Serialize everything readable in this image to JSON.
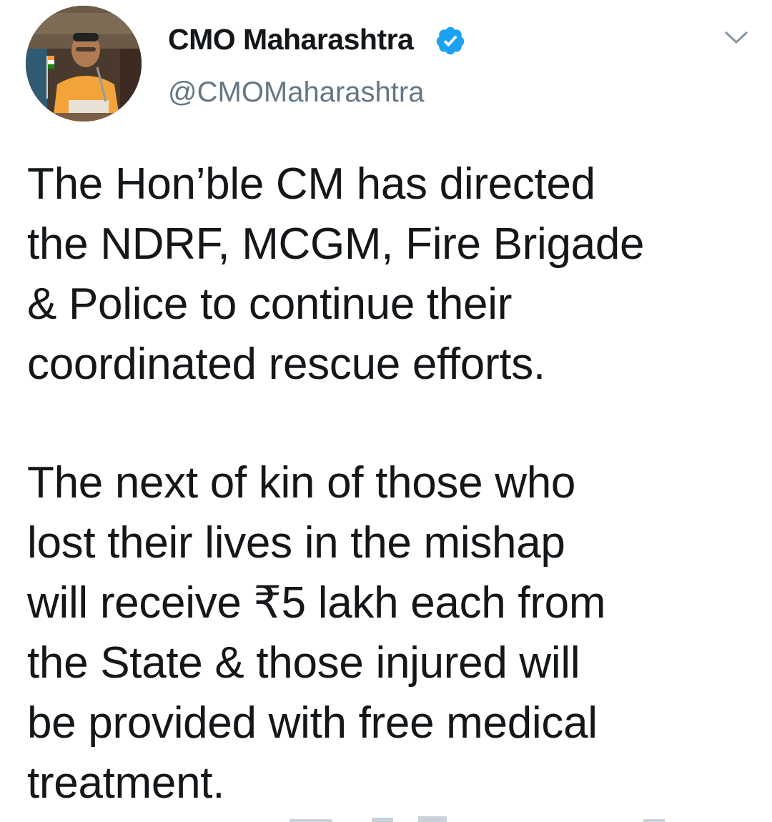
{
  "tweet": {
    "display_name": "CMO Maharashtra",
    "handle": "@CMOMaharashtra",
    "verified": true,
    "paragraphs": [
      "The Hon’ble CM has directed\nthe NDRF, MCGM, Fire Brigade\n& Police to continue their\ncoordinated rescue efforts.",
      "The next of kin of those who\nlost their lives in the mishap\nwill receive ₹5 lakh each from\nthe State & those injured will\nbe provided with free medical\ntreatment."
    ]
  },
  "icons": {
    "verified": "verified-badge-icon",
    "menu": "chevron-down-icon"
  },
  "colors": {
    "verified_blue": "#1da1f2",
    "text": "#14171a",
    "secondary_text": "#657786",
    "chevron": "#8899a6"
  }
}
